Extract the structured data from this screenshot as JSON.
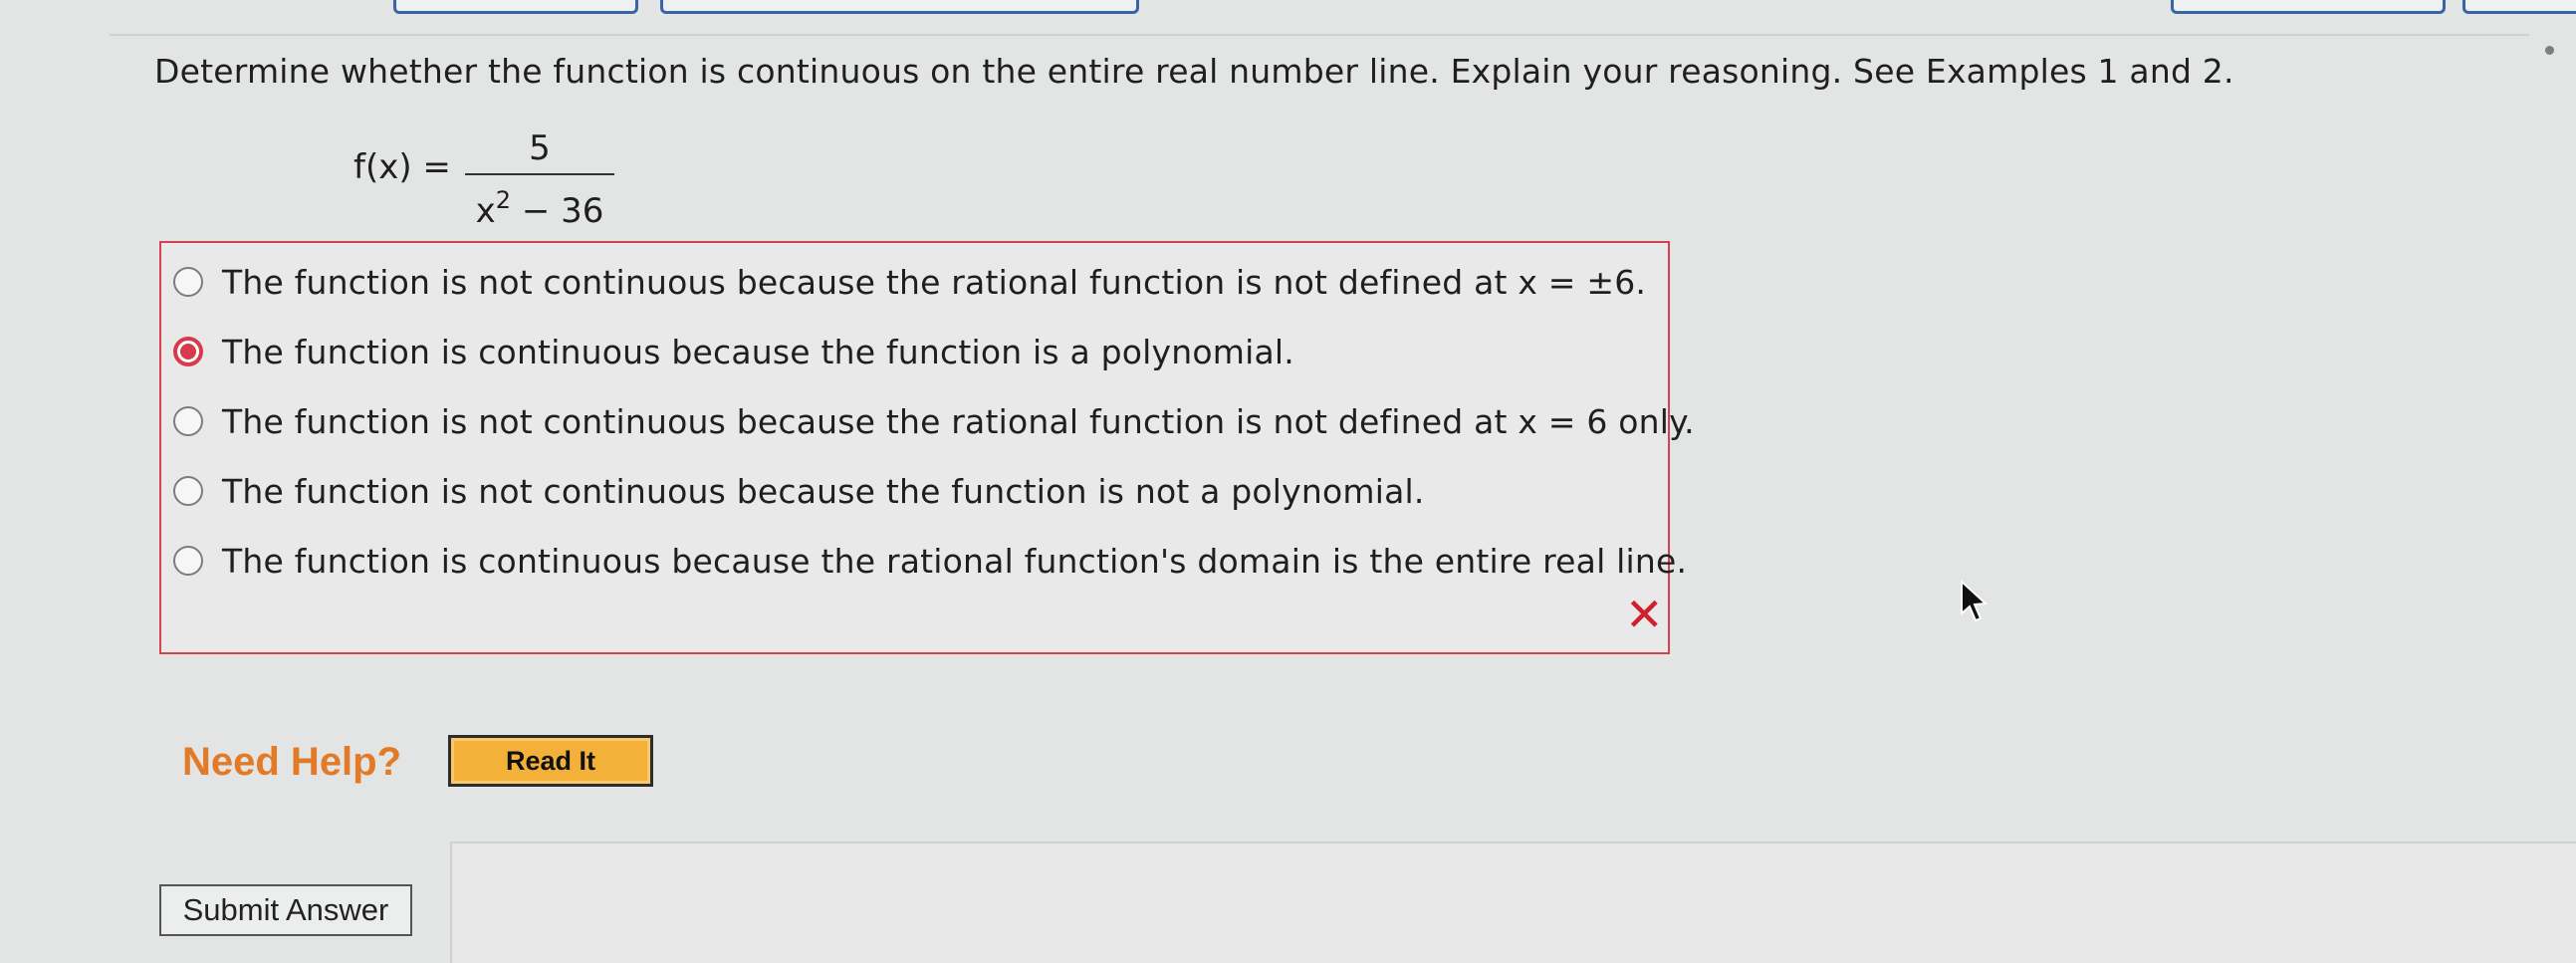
{
  "question": {
    "prompt": "Determine whether the function is continuous on the entire real number line. Explain your reasoning. See Examples 1 and 2."
  },
  "formula": {
    "lhs": "f(x) =",
    "numerator": "5",
    "denominator_base": "x",
    "denominator_exponent": "2",
    "denominator_rest": " − 36"
  },
  "options": [
    {
      "label": "The function is not continuous because the rational function is not defined at x = ±6.",
      "selected": false
    },
    {
      "label": "The function is continuous because the function is a polynomial.",
      "selected": true
    },
    {
      "label": "The function is not continuous because the rational function is not defined at x = 6 only.",
      "selected": false
    },
    {
      "label": "The function is not continuous because the function is not a polynomial.",
      "selected": false
    },
    {
      "label": "The function is continuous because the rational function's domain is the entire real line.",
      "selected": false
    }
  ],
  "feedback": {
    "mark": "✕",
    "mark_color": "#d0202e"
  },
  "help": {
    "need_help": "Need Help?",
    "read_it": "Read It"
  },
  "submit": {
    "label": "Submit Answer"
  },
  "colors": {
    "answer_border": "#d4424f",
    "selected_radio": "#d73a4a",
    "need_help": "#e27a27",
    "read_it_bg": "#f4b13a"
  }
}
